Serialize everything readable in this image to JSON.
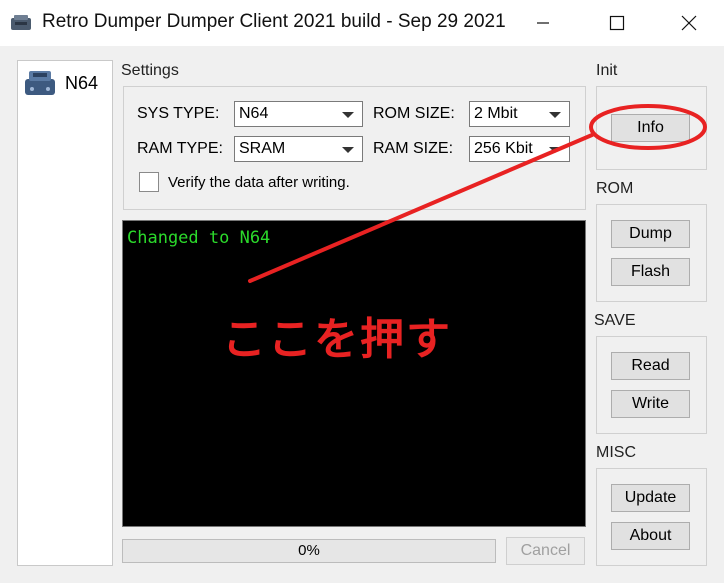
{
  "window": {
    "title": "Retro Dumper Dumper Client 2021 build - Sep 29 2021",
    "icons": {
      "app": "console-app-icon",
      "minimize": "minimize-icon",
      "maximize": "maximize-icon",
      "close": "close-icon"
    }
  },
  "sidebar": {
    "items": [
      {
        "label": "N64",
        "icon": "n64-console-icon"
      }
    ]
  },
  "settings": {
    "group_label": "Settings",
    "sys_type_label": "SYS TYPE:",
    "sys_type_value": "N64",
    "rom_size_label": "ROM SIZE:",
    "rom_size_value": "2 Mbit",
    "ram_type_label": "RAM TYPE:",
    "ram_type_value": "SRAM",
    "ram_size_label": "RAM SIZE:",
    "ram_size_value": "256 Kbit",
    "verify_label": "Verify the data after writing.",
    "verify_checked": false
  },
  "console": {
    "lines": [
      "Changed to N64"
    ],
    "text_color": "#2bd92b"
  },
  "progress": {
    "value": 0,
    "label": "0%"
  },
  "cancel_label": "Cancel",
  "side": {
    "init": {
      "label": "Init",
      "info_label": "Info"
    },
    "rom": {
      "label": "ROM",
      "dump_label": "Dump",
      "flash_label": "Flash"
    },
    "save": {
      "label": "SAVE",
      "read_label": "Read",
      "write_label": "Write"
    },
    "misc": {
      "label": "MISC",
      "update_label": "Update",
      "about_label": "About"
    }
  },
  "annotation": {
    "text": "ここを押す",
    "color": "#e82222"
  }
}
